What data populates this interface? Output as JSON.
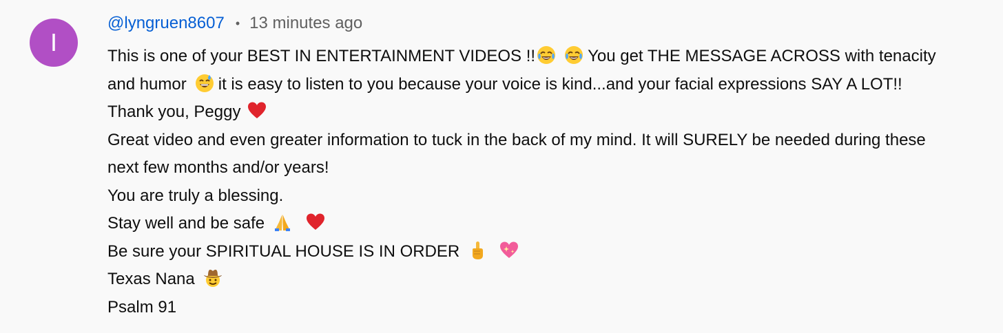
{
  "comment": {
    "avatar_letter": "I",
    "avatar_color": "#b14fc5",
    "author": "@lyngruen8607",
    "separator": "•",
    "timestamp": "13 minutes ago",
    "lines": [
      {
        "t1": "This is one of your BEST IN ENTERTAINMENT VIDEOS !!",
        "e1": "face-with-tears-of-joy-icon",
        "e2": "face-with-tears-of-joy-icon",
        "t2": "You get THE MESSAGE ACROSS with tenacity"
      },
      {
        "t1": "and humor",
        "e1": "grinning-face-with-sweat-icon",
        "t2": "it is easy to listen to you because your voice is kind...and your facial expressions SAY A LOT!!"
      },
      {
        "t1": "Thank you, Peggy",
        "e1": "red-heart-icon"
      },
      {
        "t1": "Great video and even greater information to tuck in the back of my mind. It will SURELY be needed during these"
      },
      {
        "t1": "next few months and/or years!"
      },
      {
        "t1": "You are truly a blessing."
      },
      {
        "t1": "Stay well and be safe",
        "e1": "folded-hands-icon",
        "e2": "red-heart-icon"
      },
      {
        "t1": "Be sure your SPIRITUAL HOUSE IS IN ORDER",
        "e1": "index-pointing-up-icon",
        "e2": "sparkling-heart-icon"
      },
      {
        "t1": "Texas Nana",
        "e1": "cowboy-hat-face-icon"
      },
      {
        "t1": "Psalm 91"
      }
    ]
  }
}
